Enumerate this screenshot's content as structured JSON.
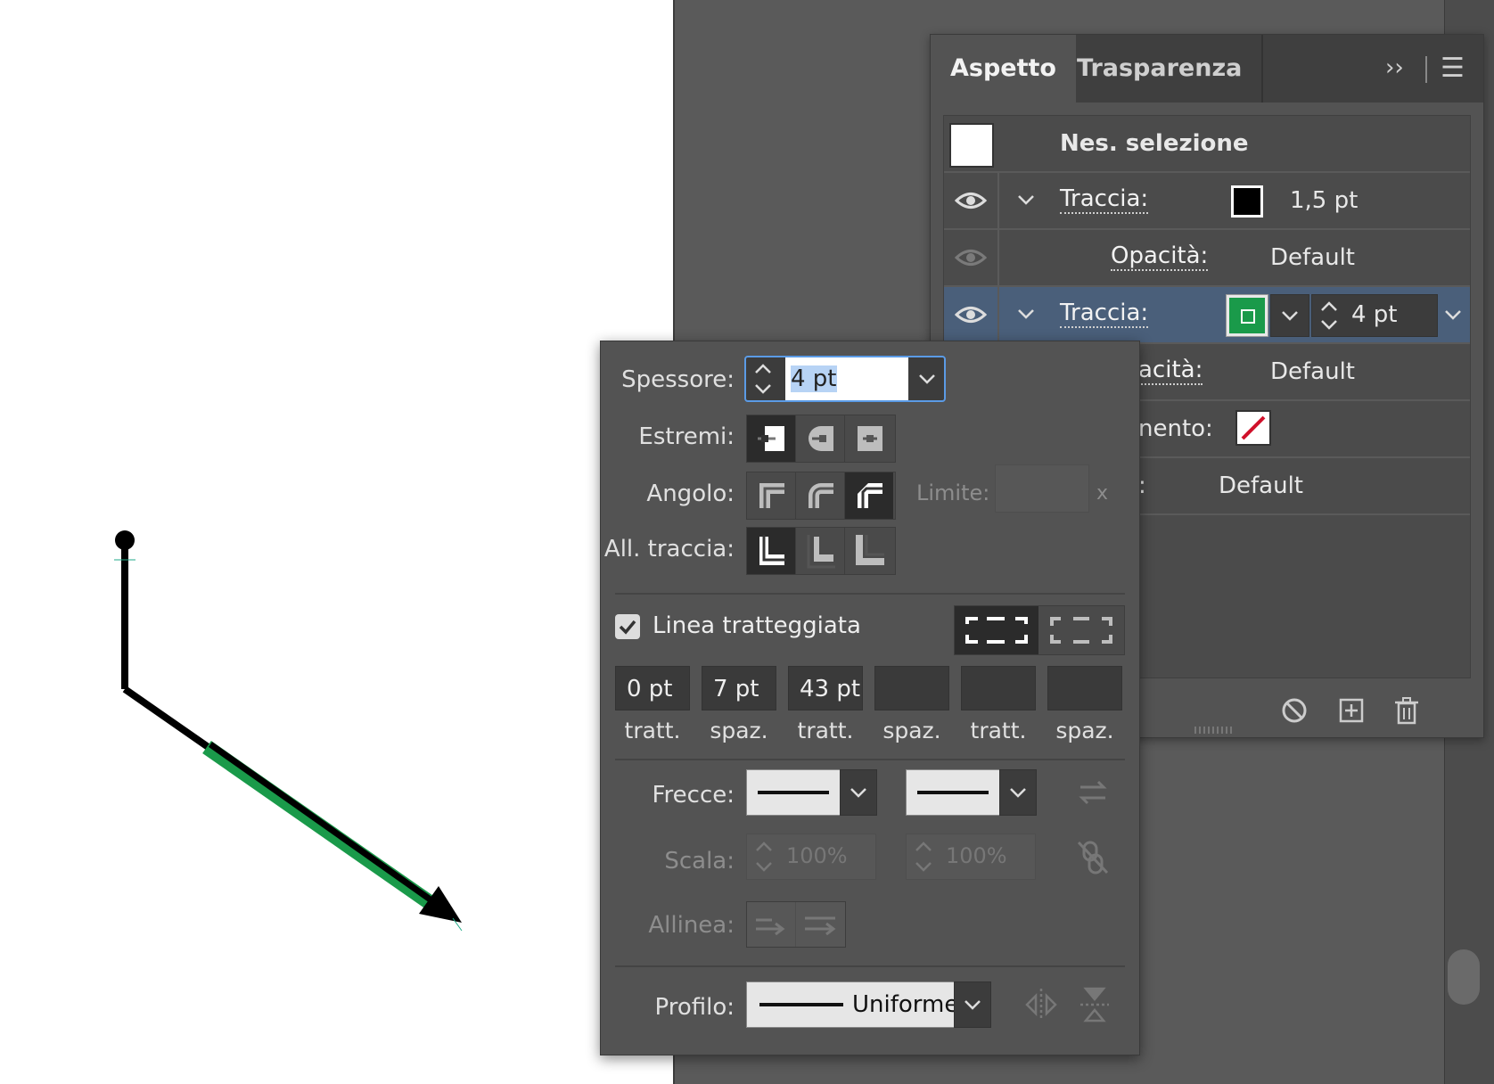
{
  "appearance_panel": {
    "tabs": [
      {
        "label": "Aspetto"
      },
      {
        "label": "Trasparenza"
      }
    ],
    "collapse_glyph": "››",
    "menu_glyph": "☰",
    "selection_label": "Nes. selezione",
    "rows": [
      {
        "label": "Traccia:",
        "value": "1,5 pt",
        "swatch_color": "#000000"
      },
      {
        "label": "Opacità:",
        "value": "Default"
      },
      {
        "label": "Traccia:",
        "value": "4 pt",
        "swatch_color": "#1a9a4a"
      },
      {
        "label": "acità:",
        "value": "Default"
      },
      {
        "label": "nento:"
      },
      {
        "label": ":",
        "value": "Default"
      }
    ]
  },
  "stroke_panel": {
    "weight_label": "Spessore:",
    "weight_value": "4 pt",
    "caps_label": "Estremi:",
    "corner_label": "Angolo:",
    "limit_label": "Limite:",
    "limit_suffix": "x",
    "align_label": "All. traccia:",
    "dashed_label": "Linea tratteggiata",
    "dashed_checked": true,
    "dashes": [
      {
        "value": "0 pt",
        "label": "tratt."
      },
      {
        "value": "7 pt",
        "label": "spaz."
      },
      {
        "value": "43 pt",
        "label": "tratt."
      },
      {
        "value": "",
        "label": "spaz."
      },
      {
        "value": "",
        "label": "tratt."
      },
      {
        "value": "",
        "label": "spaz."
      }
    ],
    "arrows_label": "Frecce:",
    "scale_label": "Scala:",
    "scale_start": "100%",
    "scale_end": "100%",
    "align_arrows_label": "Allinea:",
    "profile_label": "Profilo:",
    "profile_value": "Uniforme"
  },
  "colors": {
    "accent_green": "#1a9a4a",
    "selection_blue": "#4a5f7a",
    "focus_blue": "#5b9be6"
  }
}
